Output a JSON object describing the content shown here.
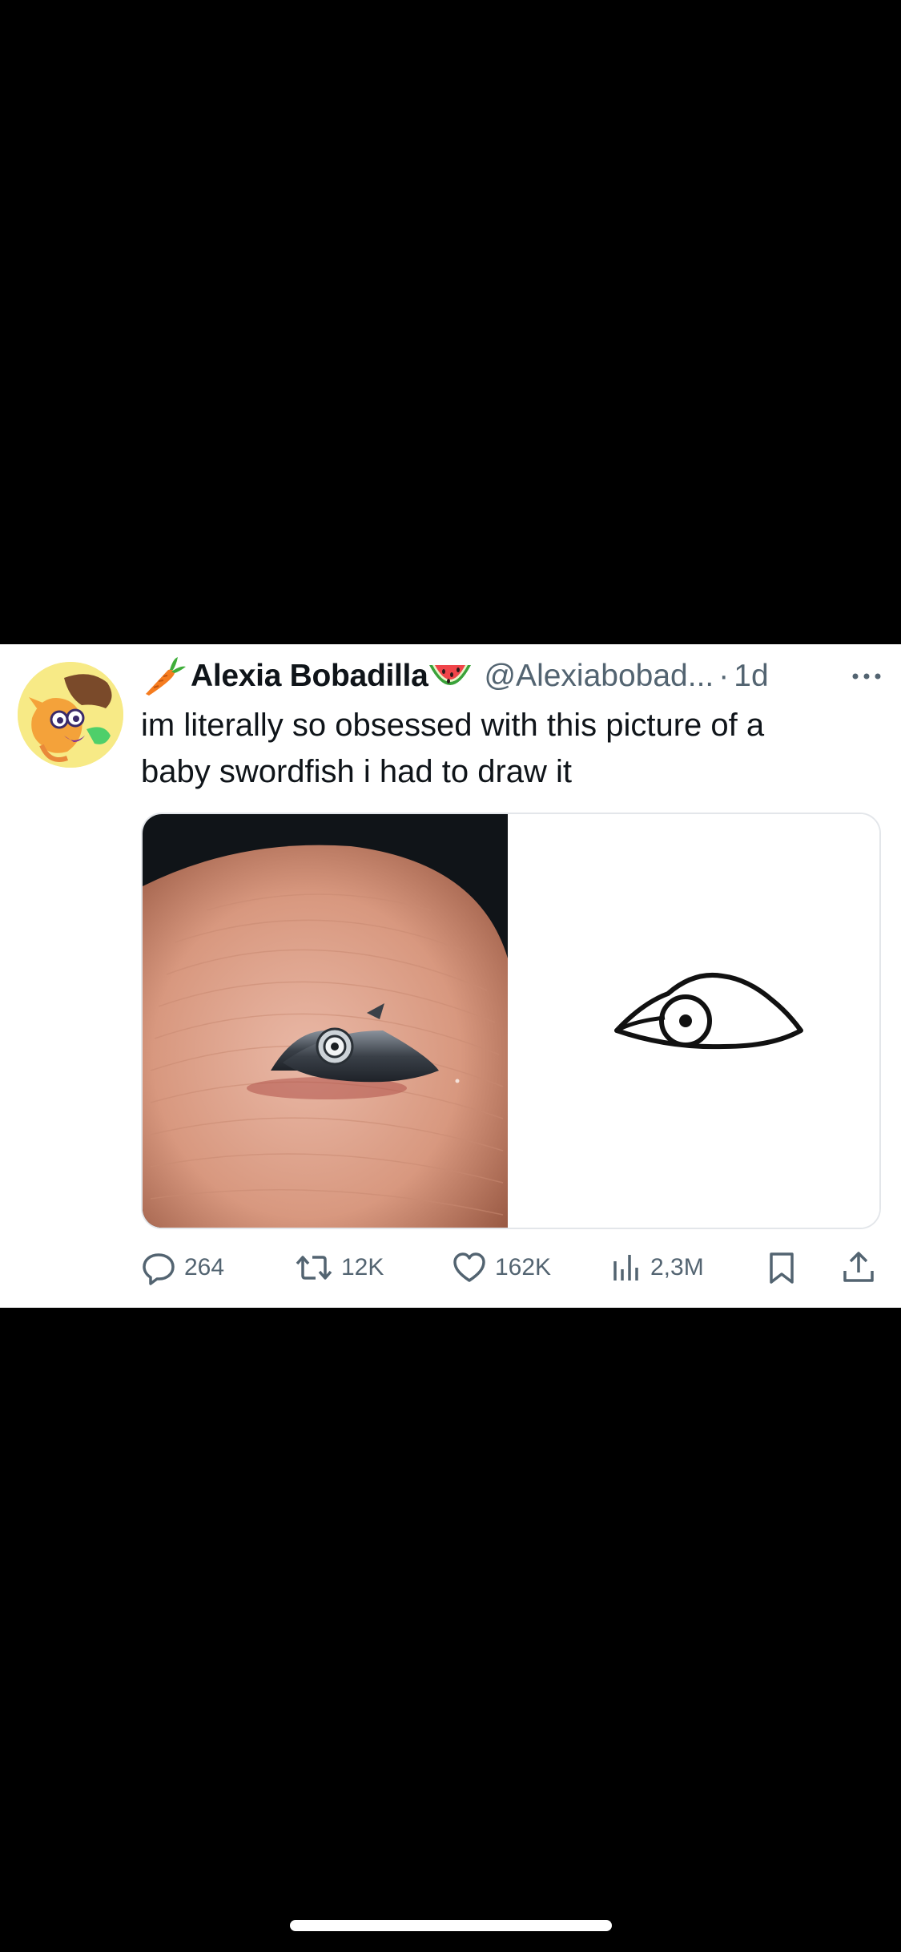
{
  "tweet": {
    "display_name": "Alexia Bobadilla",
    "handle": "@Alexiabobad...",
    "separator": "·",
    "time": "1d",
    "name_emojis": [
      "carrot-icon",
      "watermelon-icon"
    ],
    "text": "im literally so obsessed with this picture of a\nbaby swordfish i had to draw it",
    "media": [
      {
        "kind": "photo",
        "subject": "baby swordfish on fingertip"
      },
      {
        "kind": "drawing",
        "subject": "eye drawing"
      }
    ],
    "actions": {
      "replies": "264",
      "reposts": "12K",
      "likes": "162K",
      "views": "2,3M"
    }
  },
  "colors": {
    "background": "#000000",
    "card": "#ffffff",
    "text_primary": "#0f1419",
    "text_secondary": "#536471",
    "home_indicator": "#ffffff"
  }
}
